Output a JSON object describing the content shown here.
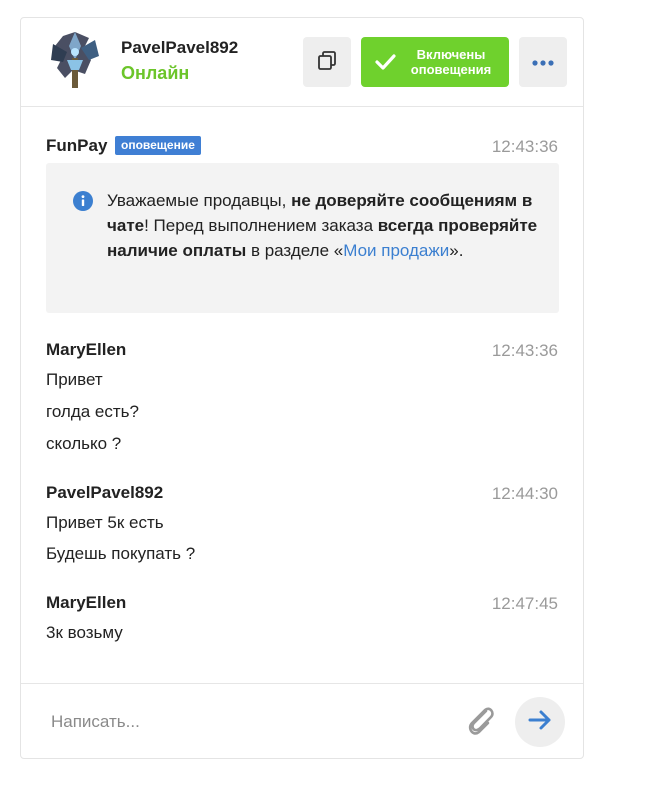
{
  "header": {
    "contact_name": "PavelPavel892",
    "contact_status": "Онлайн",
    "notify_button_line1": "Включены",
    "notify_button_line2": "оповещения",
    "status_color": "#6cc52a",
    "notify_color": "#6fd12d"
  },
  "icons": {
    "copy": "copy-icon",
    "check": "check-icon",
    "more": "more-dots-icon",
    "info": "info-icon",
    "attach": "paperclip-icon",
    "send": "arrow-right-icon"
  },
  "messages": [
    {
      "author": "FunPay",
      "badge": "оповещение",
      "time": "12:43:36",
      "notice": {
        "t1": "Уважаемые продавцы, ",
        "b1": "не доверяйте сообщениям в чате",
        "t2": "! Перед выполнением заказа ",
        "b2": "всегда проверяйте наличие оплаты",
        "t3": " в разделе «",
        "link": "Мои продажи",
        "t4": "»."
      }
    },
    {
      "author": "MaryEllen",
      "time": "12:43:36",
      "lines": [
        "Привет",
        "голда есть?",
        "сколько ?"
      ]
    },
    {
      "author": "PavelPavel892",
      "time": "12:44:30",
      "lines": [
        "Привет 5к есть",
        "Будешь покупать ?"
      ]
    },
    {
      "author": "MaryEllen",
      "time": "12:47:45",
      "lines": [
        "3к возьму"
      ]
    }
  ],
  "composer": {
    "placeholder": "Написать..."
  }
}
